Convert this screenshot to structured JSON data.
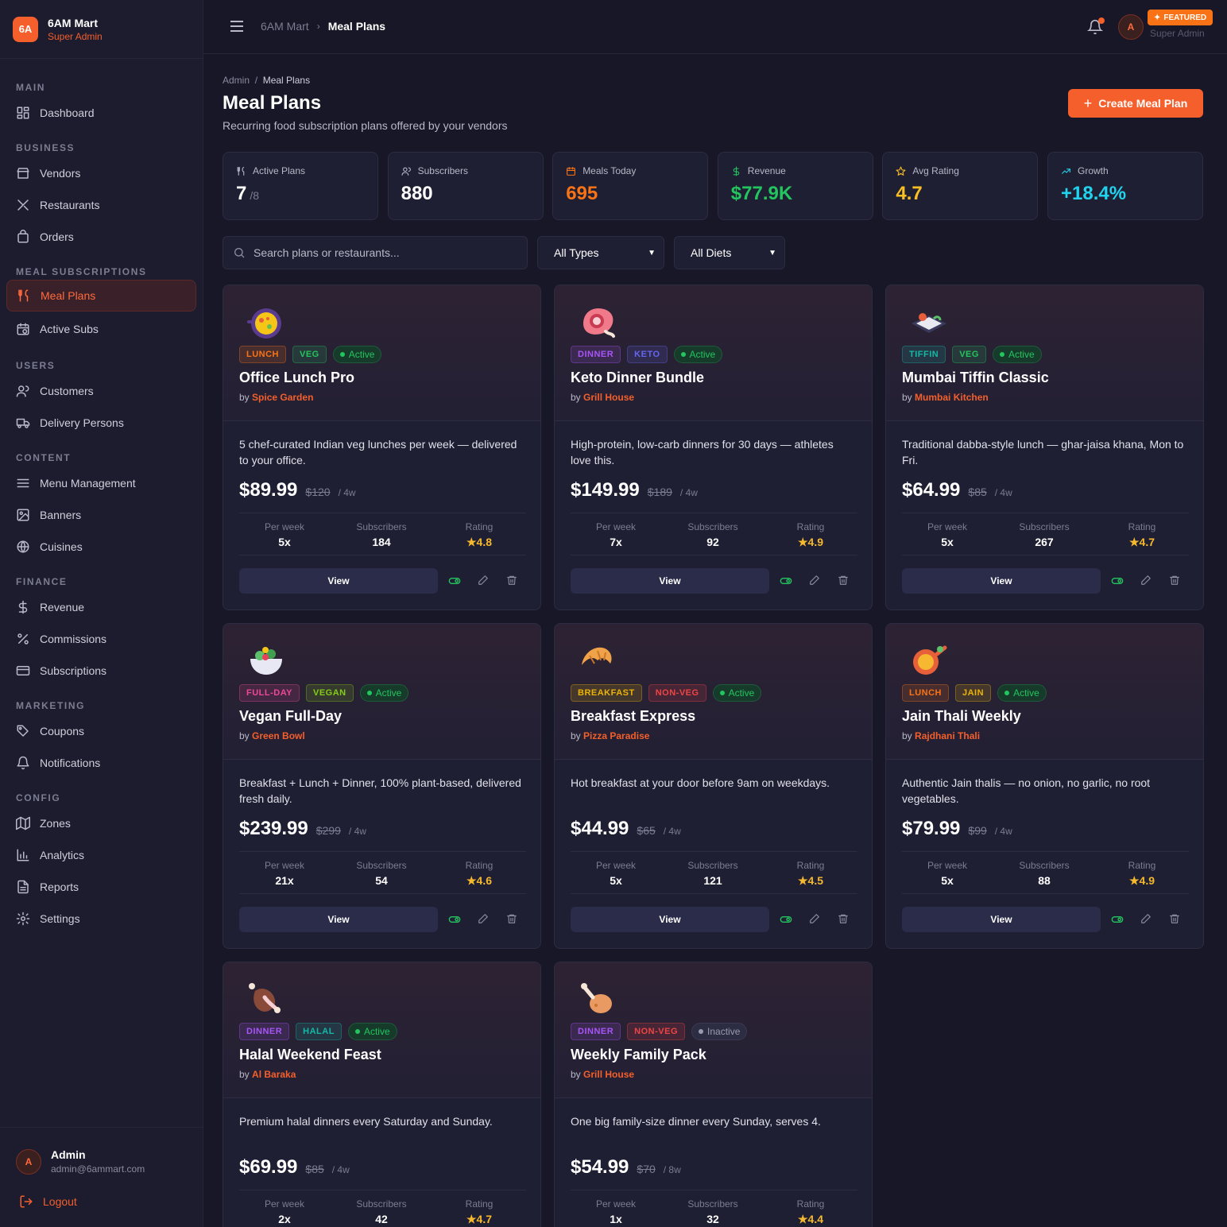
{
  "brand": {
    "logo": "6A",
    "name": "6AM Mart",
    "role": "Super Admin"
  },
  "sidebar": {
    "sections": [
      {
        "label": "MAIN",
        "items": [
          {
            "label": "Dashboard",
            "icon": "dashboard-icon"
          }
        ]
      },
      {
        "label": "BUSINESS",
        "items": [
          {
            "label": "Vendors",
            "icon": "store-icon"
          },
          {
            "label": "Restaurants",
            "icon": "utensils-cross-icon"
          },
          {
            "label": "Orders",
            "icon": "bag-icon"
          }
        ]
      },
      {
        "label": "MEAL SUBSCRIPTIONS",
        "items": [
          {
            "label": "Meal Plans",
            "icon": "fork-knife-icon",
            "active": true
          },
          {
            "label": "Active Subs",
            "icon": "calendar-clock-icon"
          }
        ]
      },
      {
        "label": "USERS",
        "items": [
          {
            "label": "Customers",
            "icon": "users-icon"
          },
          {
            "label": "Delivery Persons",
            "icon": "truck-icon"
          }
        ]
      },
      {
        "label": "CONTENT",
        "items": [
          {
            "label": "Menu Management",
            "icon": "menu-lines-icon"
          },
          {
            "label": "Banners",
            "icon": "image-icon"
          },
          {
            "label": "Cuisines",
            "icon": "globe-icon"
          }
        ]
      },
      {
        "label": "FINANCE",
        "items": [
          {
            "label": "Revenue",
            "icon": "dollar-icon"
          },
          {
            "label": "Commissions",
            "icon": "percent-icon"
          },
          {
            "label": "Subscriptions",
            "icon": "card-icon"
          }
        ]
      },
      {
        "label": "MARKETING",
        "items": [
          {
            "label": "Coupons",
            "icon": "tag-icon"
          },
          {
            "label": "Notifications",
            "icon": "bell-icon"
          }
        ]
      },
      {
        "label": "CONFIG",
        "items": [
          {
            "label": "Zones",
            "icon": "map-icon"
          },
          {
            "label": "Analytics",
            "icon": "bar-chart-icon"
          },
          {
            "label": "Reports",
            "icon": "file-icon"
          },
          {
            "label": "Settings",
            "icon": "gear-icon"
          }
        ]
      }
    ],
    "footer": {
      "avatar": "A",
      "name": "Admin",
      "email": "admin@6ammart.com",
      "logout": "Logout"
    }
  },
  "topbar": {
    "crumb_root": "6AM Mart",
    "crumb_current": "Meal Plans",
    "avatar": "A",
    "featured": "FEATURED",
    "role": "Super Admin"
  },
  "page": {
    "crumb_root": "Admin",
    "crumb_sep": "/",
    "crumb_current": "Meal Plans",
    "title": "Meal Plans",
    "subtitle": "Recurring food subscription plans offered by your vendors",
    "create_label": "Create Meal Plan"
  },
  "stats": [
    {
      "label": "Active Plans",
      "value": "7",
      "suffix": "/8",
      "color": "#ffffff",
      "icon": "fork-knife-icon"
    },
    {
      "label": "Subscribers",
      "value": "880",
      "suffix": "",
      "color": "#ffffff",
      "icon": "users-icon"
    },
    {
      "label": "Meals Today",
      "value": "695",
      "suffix": "",
      "color": "#f97316",
      "icon": "calendar-icon"
    },
    {
      "label": "Revenue",
      "value": "$77.9K",
      "suffix": "",
      "color": "#22c55e",
      "icon": "dollar-icon"
    },
    {
      "label": "Avg Rating",
      "value": "4.7",
      "suffix": "",
      "color": "#fbbf24",
      "icon": "star-icon"
    },
    {
      "label": "Growth",
      "value": "+18.4%",
      "suffix": "",
      "color": "#22d3ee",
      "icon": "trend-up-icon"
    }
  ],
  "filters": {
    "search_placeholder": "Search plans or restaurants...",
    "type_value": "All Types",
    "diet_value": "All Diets"
  },
  "metric_labels": {
    "per_week": "Per week",
    "subscribers": "Subscribers",
    "rating": "Rating"
  },
  "view_label": "View",
  "plans": [
    {
      "emoji": "paella-pan",
      "meal": "LUNCH",
      "diet": "VEG",
      "status": "Active",
      "title": "Office Lunch Pro",
      "by": "by",
      "vendor": "Spice Garden",
      "desc": "5 chef-curated Indian veg lunches per week — delivered to your office.",
      "price": "$89.99",
      "old": "$120",
      "per": "/ 4w",
      "per_week": "5x",
      "subscribers": "184",
      "rating": "★4.8"
    },
    {
      "emoji": "meat",
      "meal": "DINNER",
      "diet": "KETO",
      "status": "Active",
      "title": "Keto Dinner Bundle",
      "by": "by",
      "vendor": "Grill House",
      "desc": "High-protein, low-carb dinners for 30 days — athletes love this.",
      "price": "$149.99",
      "old": "$189",
      "per": "/ 4w",
      "per_week": "7x",
      "subscribers": "92",
      "rating": "★4.9"
    },
    {
      "emoji": "bento",
      "meal": "TIFFIN",
      "diet": "VEG",
      "status": "Active",
      "title": "Mumbai Tiffin Classic",
      "by": "by",
      "vendor": "Mumbai Kitchen",
      "desc": "Traditional dabba-style lunch — ghar-jaisa khana, Mon to Fri.",
      "price": "$64.99",
      "old": "$85",
      "per": "/ 4w",
      "per_week": "5x",
      "subscribers": "267",
      "rating": "★4.7"
    },
    {
      "emoji": "salad-bowl",
      "meal": "FULL-DAY",
      "diet": "VEGAN",
      "status": "Active",
      "title": "Vegan Full-Day",
      "by": "by",
      "vendor": "Green Bowl",
      "desc": "Breakfast + Lunch + Dinner, 100% plant-based, delivered fresh daily.",
      "price": "$239.99",
      "old": "$299",
      "per": "/ 4w",
      "per_week": "21x",
      "subscribers": "54",
      "rating": "★4.6"
    },
    {
      "emoji": "croissant",
      "meal": "BREAKFAST",
      "diet": "NON-VEG",
      "status": "Active",
      "title": "Breakfast Express",
      "by": "by",
      "vendor": "Pizza Paradise",
      "desc": "Hot breakfast at your door before 9am on weekdays.",
      "price": "$44.99",
      "old": "$65",
      "per": "/ 4w",
      "per_week": "5x",
      "subscribers": "121",
      "rating": "★4.5"
    },
    {
      "emoji": "curry-pan",
      "meal": "LUNCH",
      "diet": "JAIN",
      "status": "Active",
      "title": "Jain Thali Weekly",
      "by": "by",
      "vendor": "Rajdhani Thali",
      "desc": "Authentic Jain thalis — no onion, no garlic, no root vegetables.",
      "price": "$79.99",
      "old": "$99",
      "per": "/ 4w",
      "per_week": "5x",
      "subscribers": "88",
      "rating": "★4.9"
    },
    {
      "emoji": "meat-bone",
      "meal": "DINNER",
      "diet": "HALAL",
      "status": "Active",
      "title": "Halal Weekend Feast",
      "by": "by",
      "vendor": "Al Baraka",
      "desc": "Premium halal dinners every Saturday and Sunday.",
      "price": "$69.99",
      "old": "$85",
      "per": "/ 4w",
      "per_week": "2x",
      "subscribers": "42",
      "rating": "★4.7"
    },
    {
      "emoji": "poultry-leg",
      "meal": "DINNER",
      "diet": "NON-VEG",
      "status": "Inactive",
      "title": "Weekly Family Pack",
      "by": "by",
      "vendor": "Grill House",
      "desc": "One big family-size dinner every Sunday, serves 4.",
      "price": "$54.99",
      "old": "$70",
      "per": "/ 8w",
      "per_week": "1x",
      "subscribers": "32",
      "rating": "★4.4"
    }
  ],
  "tag_colors": {
    "LUNCH": "#f97316",
    "DINNER": "#a855f7",
    "TIFFIN": "#14b8a6",
    "FULL-DAY": "#ec4899",
    "BREAKFAST": "#eab308",
    "VEG": "#22c55e",
    "KETO": "#6366f1",
    "VEGAN": "#84cc16",
    "NON-VEG": "#ef4444",
    "JAIN": "#eab308",
    "HALAL": "#14b8a6"
  }
}
